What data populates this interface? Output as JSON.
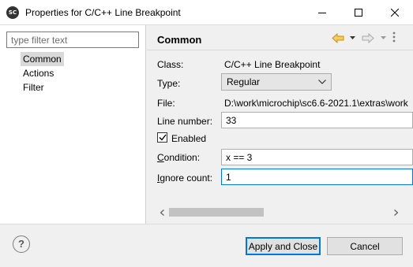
{
  "window": {
    "icon_text": "SC",
    "title": "Properties for C/C++ Line Breakpoint"
  },
  "sidebar": {
    "filter_placeholder": "type filter text",
    "items": [
      {
        "label": "Common",
        "selected": true
      },
      {
        "label": "Actions",
        "selected": false
      },
      {
        "label": "Filter",
        "selected": false
      }
    ]
  },
  "page": {
    "title": "Common",
    "class_label": "Class:",
    "class_value": "C/C++ Line Breakpoint",
    "type_label": "Type:",
    "type_value": "Regular",
    "file_label": "File:",
    "file_value": "D:\\work\\microchip\\sc6.6-2021.1\\extras\\work",
    "line_label": "Line number:",
    "line_value": "33",
    "enabled_label": "Enabled",
    "enabled_checked": true,
    "condition_label_mnemonic": "C",
    "condition_label_rest": "ondition:",
    "condition_value": "x == 3",
    "ignore_label_mnemonic": "I",
    "ignore_label_rest": "gnore count:",
    "ignore_value": "1"
  },
  "footer": {
    "help_icon_text": "?",
    "apply_close_label": "Apply and Close",
    "cancel_label": "Cancel"
  },
  "colors": {
    "accent": "#0078d7",
    "back_arrow": "#e8b23a",
    "background": "#f0f0f0"
  }
}
